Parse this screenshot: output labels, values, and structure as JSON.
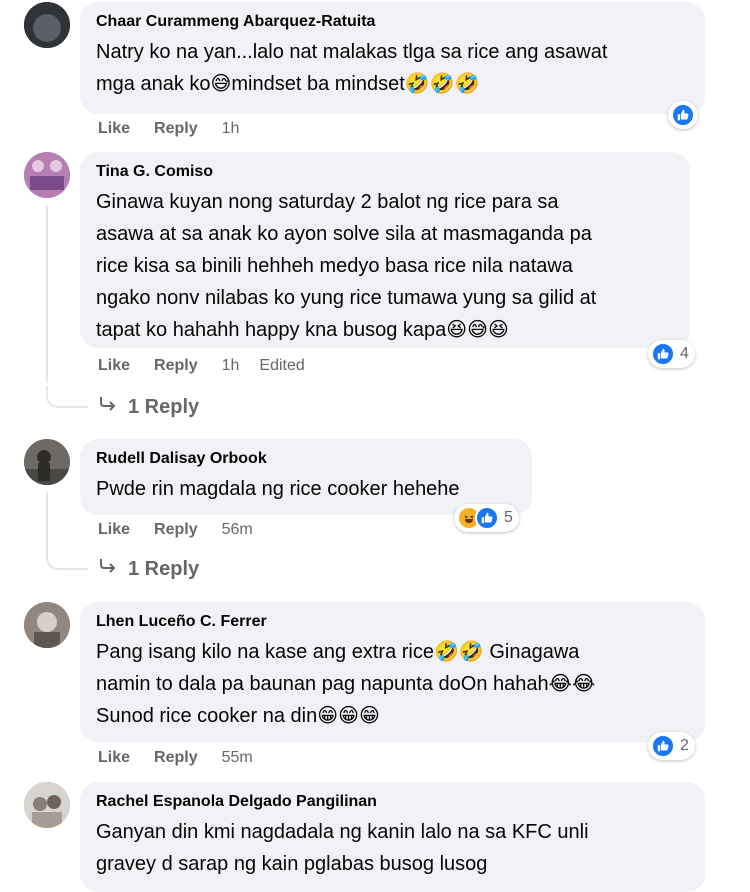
{
  "comments": [
    {
      "author": "Chaar Curammeng Abarquez-Ratuita",
      "lines": [
        "Natry ko na yan...lalo nat malakas tlga sa rice ang asawat",
        "mga anak ko😅mindset ba mindset🤣🤣🤣"
      ],
      "like_label": "Like",
      "reply_label": "Reply",
      "time": "1h",
      "reactions": {
        "icons": [
          "like-icon"
        ],
        "count": ""
      }
    },
    {
      "author": "Tina G. Comiso",
      "lines": [
        "Ginawa kuyan nong saturday 2 balot ng rice para sa",
        "asawa at sa anak ko ayon solve sila at masmaganda pa",
        "rice kisa sa binili hehheh medyo basa rice nila natawa",
        "ngako nonv nilabas ko yung rice tumawa yung sa gilid at",
        "tapat ko hahahh happy kna busog kapa😆😅😆"
      ],
      "like_label": "Like",
      "reply_label": "Reply",
      "time": "1h",
      "edited": "Edited",
      "reactions": {
        "icons": [
          "like-icon"
        ],
        "count": "4"
      },
      "replies_label": "1 Reply"
    },
    {
      "author": "Rudell Dalisay Orbook",
      "lines": [
        "Pwde rin magdala ng rice cooker hehehe"
      ],
      "like_label": "Like",
      "reply_label": "Reply",
      "time": "56m",
      "reactions": {
        "icons": [
          "haha-icon",
          "like-icon"
        ],
        "count": "5"
      },
      "replies_label": "1 Reply"
    },
    {
      "author": "Lhen Luceño C. Ferrer",
      "lines": [
        "Pang isang kilo na kase ang extra rice🤣🤣 Ginagawa",
        "namin to dala pa baunan pag napunta doOn hahah😂😂",
        "Sunod rice cooker na din😁😁😁"
      ],
      "like_label": "Like",
      "reply_label": "Reply",
      "time": "55m",
      "reactions": {
        "icons": [
          "like-icon"
        ],
        "count": "2"
      }
    },
    {
      "author": "Rachel Espanola Delgado Pangilinan",
      "lines": [
        "Ganyan din kmi nagdadala ng kanin lalo na sa KFC unli",
        "gravey d sarap ng kain pglabas busog lusog"
      ]
    }
  ],
  "colors": {
    "bubble": "#f0f2f5",
    "meta": "#65676b",
    "like_blue": "#1877f2",
    "haha_yellow": "#f7b125"
  }
}
